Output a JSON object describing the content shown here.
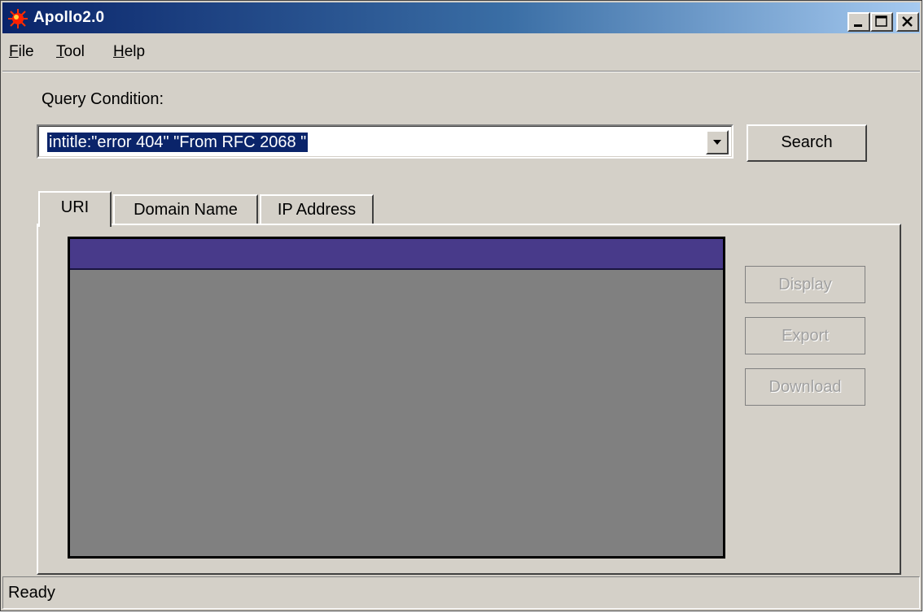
{
  "window": {
    "title": "Apollo2.0"
  },
  "menu": {
    "file": {
      "key": "F",
      "rest": "ile"
    },
    "tool": {
      "key": "T",
      "rest": "ool"
    },
    "help": {
      "key": "H",
      "rest": "elp"
    }
  },
  "query": {
    "label": "Query Condition:",
    "value": "intitle:\"error 404\" \"From RFC 2068 \"",
    "search_label": "Search"
  },
  "tabs": [
    {
      "label": "URI",
      "selected": true
    },
    {
      "label": "Domain Name",
      "selected": false
    },
    {
      "label": "IP Address",
      "selected": false
    }
  ],
  "actions": {
    "display_label": "Display",
    "export_label": "Export",
    "download_label": "Download"
  },
  "status": {
    "text": "Ready"
  },
  "colors": {
    "title_gradient_start": "#0a246a",
    "title_gradient_end": "#a6caf0",
    "list_header": "#483a8a",
    "list_body": "#808080",
    "selection": "#0a246a"
  },
  "icons": {
    "app": "sun-icon",
    "minimize": "minimize-icon",
    "maximize": "maximize-icon",
    "close": "close-icon",
    "dropdown": "chevron-down-icon"
  }
}
